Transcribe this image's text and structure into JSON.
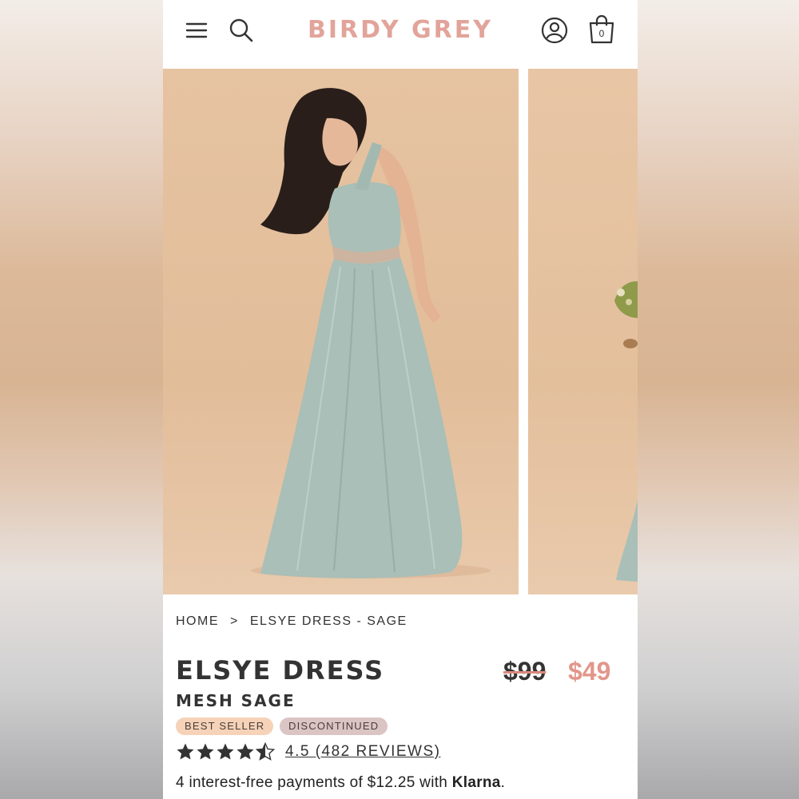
{
  "brand": "BIRDY GREY",
  "header": {
    "menu_icon": "hamburger-menu-icon",
    "search_icon": "search-icon",
    "account_icon": "user-account-icon",
    "cart_icon": "shopping-bag-icon",
    "cart_count": "0"
  },
  "gallery": {
    "images": [
      {
        "subject": "dress-photo-main"
      },
      {
        "subject": "dress-photo-next"
      }
    ]
  },
  "breadcrumb": {
    "home": "HOME",
    "separator": ">",
    "current": "ELSYE DRESS - SAGE"
  },
  "product": {
    "name": "ELSYE DRESS",
    "variant": "MESH SAGE",
    "price_original": "$99",
    "price_sale": "$49",
    "badges": [
      "BEST SELLER",
      "DISCONTINUED"
    ],
    "rating_value": 4.5,
    "rating_max": 5,
    "rating_text": "4.5 (482 REVIEWS)",
    "installments_prefix": "4 interest-free payments of $12.25 with ",
    "installments_provider": "Klarna",
    "installments_suffix": "."
  },
  "colors": {
    "brand": "#e2a49a",
    "sale_price": "#e2968a",
    "badge_best_seller": "#f5d2b8",
    "badge_discontinued": "#dbc4c4",
    "dress": "#a9bfb7"
  }
}
